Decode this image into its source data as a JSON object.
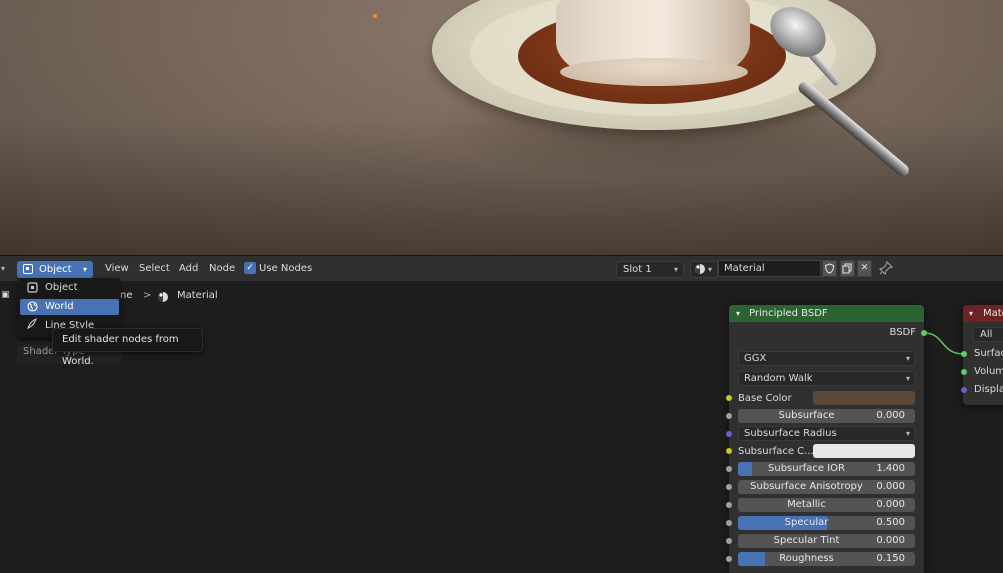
{
  "header": {
    "editor_type_label": "Object",
    "menus": [
      "View",
      "Select",
      "Add",
      "Node"
    ],
    "use_nodes_label": "Use Nodes",
    "use_nodes_checked": true,
    "slot_label": "Slot 1",
    "material_name": "Material"
  },
  "breadcrumb": {
    "partial_object": "ne",
    "material": "Material"
  },
  "object_menu": {
    "items": [
      {
        "label": "Object",
        "icon": "object-icon",
        "selected": false
      },
      {
        "label": "World",
        "icon": "world-icon",
        "selected": true
      },
      {
        "label": "Line Style",
        "icon": "line-style-icon",
        "selected": false
      }
    ],
    "shader_type_label": "Shader Type",
    "tooltip": "Edit shader nodes from World."
  },
  "bsdf_node": {
    "title": "Principled BSDF",
    "output_label": "BSDF",
    "distribution": "GGX",
    "subsurface_method": "Random Walk",
    "base_color_label": "Base Color",
    "base_color": "#5b4838",
    "subsurface_color_label": "Subsurface C...",
    "subsurface_color": "#e8e8e8",
    "subsurface_radius_label": "Subsurface Radius",
    "sliders": [
      {
        "label": "Subsurface",
        "value": "0.000",
        "fill": 0.0
      },
      {
        "label": "Subsurface IOR",
        "value": "1.400",
        "fill": 0.08
      },
      {
        "label": "Subsurface Anisotropy",
        "value": "0.000",
        "fill": 0.0
      },
      {
        "label": "Metallic",
        "value": "0.000",
        "fill": 0.0
      },
      {
        "label": "Specular",
        "value": "0.500",
        "fill": 0.5
      },
      {
        "label": "Specular Tint",
        "value": "0.000",
        "fill": 0.0
      },
      {
        "label": "Roughness",
        "value": "0.150",
        "fill": 0.15
      }
    ]
  },
  "output_node": {
    "title": "Mate",
    "target": "All",
    "inputs": [
      "Surface",
      "Volume",
      "Displac"
    ]
  },
  "colors": {
    "accent": "#4772b3",
    "shader_header": "#2b6431",
    "output_header": "#6e2323",
    "link": "#62c763"
  }
}
